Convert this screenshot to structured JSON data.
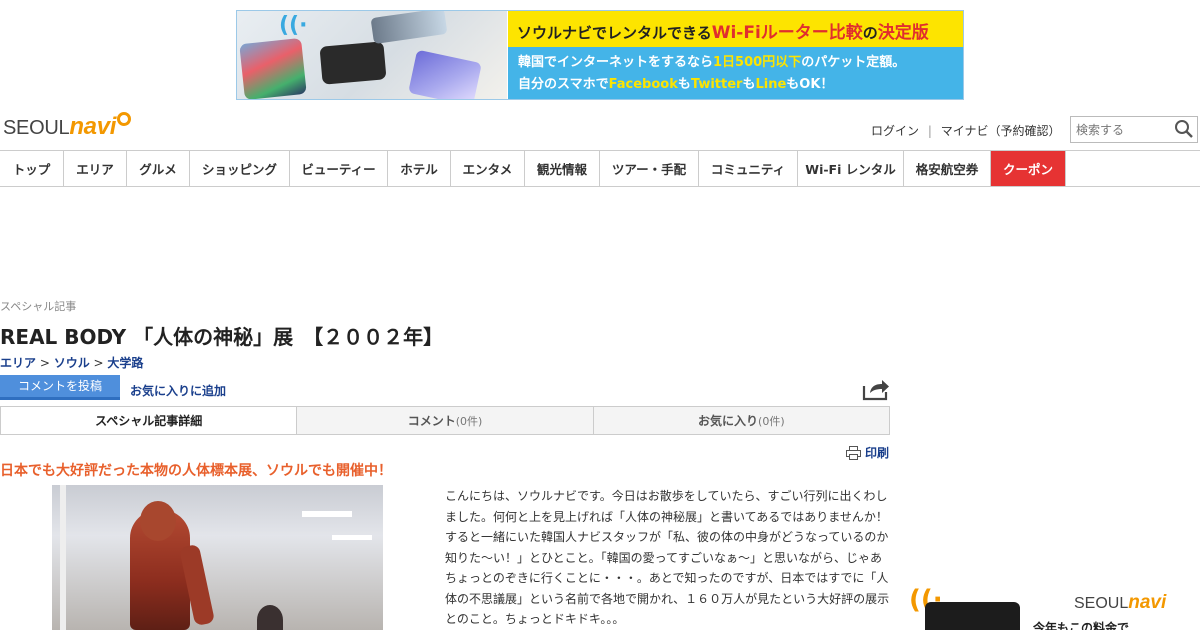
{
  "banner": {
    "top_prefix": "ソウルナビでレンタルできる",
    "top_highlight": "Wi-Fiルーター比較",
    "top_mid": "の",
    "top_end": "決定版",
    "line1_pre": "韓国でインターネットをするなら",
    "line1_hi": "1日500円以下",
    "line1_post": "のパケット定額。",
    "line2_pre": "自分のスマホで",
    "line2_fb": "Facebook",
    "line2_m1": "も",
    "line2_tw": "Twitter",
    "line2_m2": "も",
    "line2_ln": "Line",
    "line2_end": "もOK！"
  },
  "logo": {
    "seoul": "SEOUL",
    "navi": "navi"
  },
  "header": {
    "login": "ログイン",
    "sep": "|",
    "mypage": "マイナビ（予約確認）",
    "search_placeholder": "検索する"
  },
  "nav": [
    {
      "label": "トップ",
      "w": 64
    },
    {
      "label": "エリア",
      "w": 63
    },
    {
      "label": "グルメ",
      "w": 63
    },
    {
      "label": "ショッピング",
      "w": 100
    },
    {
      "label": "ビューティー",
      "w": 98
    },
    {
      "label": "ホテル",
      "w": 63
    },
    {
      "label": "エンタメ",
      "w": 74
    },
    {
      "label": "観光情報",
      "w": 75
    },
    {
      "label": "ツアー・手配",
      "w": 99
    },
    {
      "label": "コミュニティ",
      "w": 99
    },
    {
      "label": "Wi-Fi レンタル",
      "w": 106
    },
    {
      "label": "格安航空券",
      "w": 87
    },
    {
      "label": "クーポン",
      "w": 75
    }
  ],
  "article": {
    "kicker": "スペシャル記事",
    "title": "REAL BODY 「人体の神秘」展　【２００２年】",
    "crumb_area": "エリア",
    "crumb_sep": " > ",
    "crumb_seoul": "ソウル",
    "crumb_daehakro": "大学路",
    "comment_button": "コメントを投稿",
    "favorite_link": "お気に入りに追加",
    "tabs": [
      {
        "label": "スペシャル記事詳細",
        "count": ""
      },
      {
        "label": "コメント",
        "count": "(0件)"
      },
      {
        "label": "お気に入り",
        "count": "(0件)"
      }
    ],
    "print": "印刷",
    "headline": "日本でも大好評だった本物の人体標本展、ソウルでも開催中！",
    "body": "こんにちは、ソウルナビです。今日はお散歩をしていたら、すごい行列に出くわしました。何何と上を見上げれば「人体の神秘展」と書いてあるではありませんか！すると一緒にいた韓国人ナビスタッフが「私、彼の体の中身がどうなっているのか知りた～い！」とひとこと。「韓国の愛ってすごいなぁ～」と思いながら、じゃあちょっとのぞきに行くことに・・・。あとで知ったのですが、日本ではすでに「人体の不思議展」という名前で各地で開かれ、１６０万人が見たという大好評の展示とのこと。ちょっとドキドキ。。。"
  },
  "sidead": {
    "seoul": "SEOUL",
    "navi": "navi",
    "tag": "今年もこの料金で"
  }
}
